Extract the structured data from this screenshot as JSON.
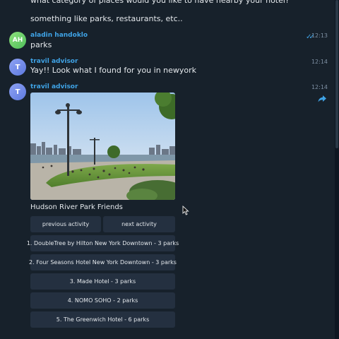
{
  "messages": {
    "cut_text": "what category of places would you like to have nearby your hotel?",
    "prompt_text": "something like parks, restaurants, etc..",
    "msg1": {
      "avatar_initials": "AH",
      "sender": "aladin handoklo",
      "text": "parks",
      "time": "12:13",
      "status": "read"
    },
    "msg2": {
      "avatar_initials": "T",
      "sender": "travil advisor",
      "text": "Yay!! Look what I found for you in newyork",
      "time": "12:14"
    },
    "msg3": {
      "avatar_initials": "T",
      "sender": "travil advisor",
      "time": "12:14",
      "caption": "Hudson River Park Friends",
      "share_icon": "share-arrow-icon"
    }
  },
  "buttons": {
    "prev": "previous activity",
    "next": "next activity",
    "hotels": [
      "1. DoubleTree by Hilton New York Downtown - 3 parks",
      "2. Four Seasons Hotel New York Downtown - 3 parks",
      "3. Made Hotel - 3 parks",
      "4. NOMO SOHO - 2 parks",
      "5. The Greenwich Hotel - 6 parks"
    ]
  },
  "colors": {
    "accent": "#3fa3e6",
    "background": "#17212b",
    "button": "#243040"
  }
}
